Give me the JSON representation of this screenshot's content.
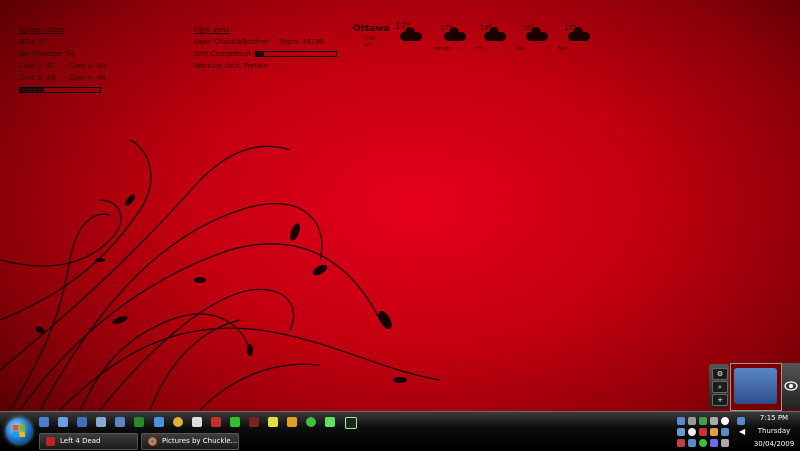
{
  "system": {
    "title": "System stats",
    "gpu": "GPU: 57",
    "northbridge": "Northbridge: 54",
    "core1": "Core 1: 47",
    "core2": "Core 2: 48",
    "core3": "Core 3: 48",
    "core4": "Core 4: 48",
    "load_fraction": 0.3
  },
  "fah": {
    "title": "F@H stats",
    "user": "User: ChuckleBrother",
    "team": "Team: 34196",
    "unit_completion_label": "Unit Completion:",
    "unit_completion_fraction": 0.1,
    "working_unit": "Working Unit: Protein"
  },
  "weather": {
    "city": "Ottawa",
    "current_temp": "17°",
    "observed": "7:34 am",
    "forecast": [
      {
        "temp": "17°",
        "day": "tonight"
      },
      {
        "temp": "19°",
        "day": "Fri"
      },
      {
        "temp": "18°",
        "day": "Sat"
      },
      {
        "temp": "17°",
        "day": "Sun"
      }
    ]
  },
  "taskbar": {
    "tasks": [
      {
        "label": "Left 4 Dead",
        "icon": "left4dead-icon"
      },
      {
        "label": "Pictures by Chuckle...",
        "icon": "chrome-icon"
      }
    ],
    "clock": {
      "time": "7:15 PM",
      "day": "Thursday",
      "date": "30/04/2009"
    }
  },
  "colors": {
    "background": "#d10018",
    "taskbar": "#0d0d0d",
    "widget_text": "#2a0000"
  }
}
